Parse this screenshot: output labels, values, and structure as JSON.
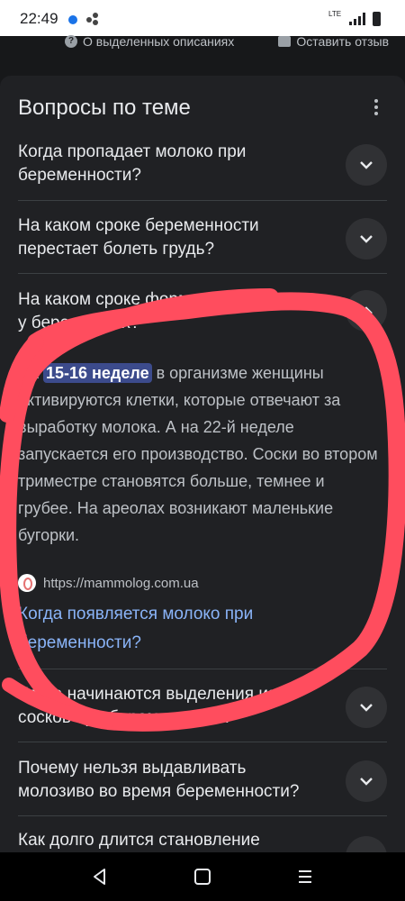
{
  "status": {
    "time": "22:49",
    "network": "LTE"
  },
  "top_links": {
    "about": "О выделенных описаниях",
    "feedback": "Оставить отзыв"
  },
  "section": {
    "title": "Вопросы по теме",
    "questions": [
      {
        "text": "Когда пропадает молоко при беременности?"
      },
      {
        "text": "На каком сроке беременности перестает болеть грудь?"
      },
      {
        "text": "На каком сроке формируется молоко у беременных?"
      },
      {
        "text": "Когда начинаются выделения из сосков при беременности?"
      },
      {
        "text": "Почему нельзя выдавливать молозиво во время беременности?"
      },
      {
        "text": "Как долго длится становление"
      }
    ]
  },
  "answer": {
    "prefix": "На ",
    "highlight": "15-16 неделе",
    "body": " в организме женщины активируются клетки, которые отвечают за выработку молока. А на 22-й неделе запускается его производство. Соски во втором триместре становятся больше, темнее и грубее. На ареолах возникают маленькие бугорки.",
    "source_url": "https://mammolog.com.ua",
    "link_text": "Когда появляется молоко при беременности?"
  },
  "colors": {
    "background": "#202124",
    "link": "#8ab4f8",
    "highlight": "#3c4b8c",
    "annotation": "#ff4d5e"
  }
}
